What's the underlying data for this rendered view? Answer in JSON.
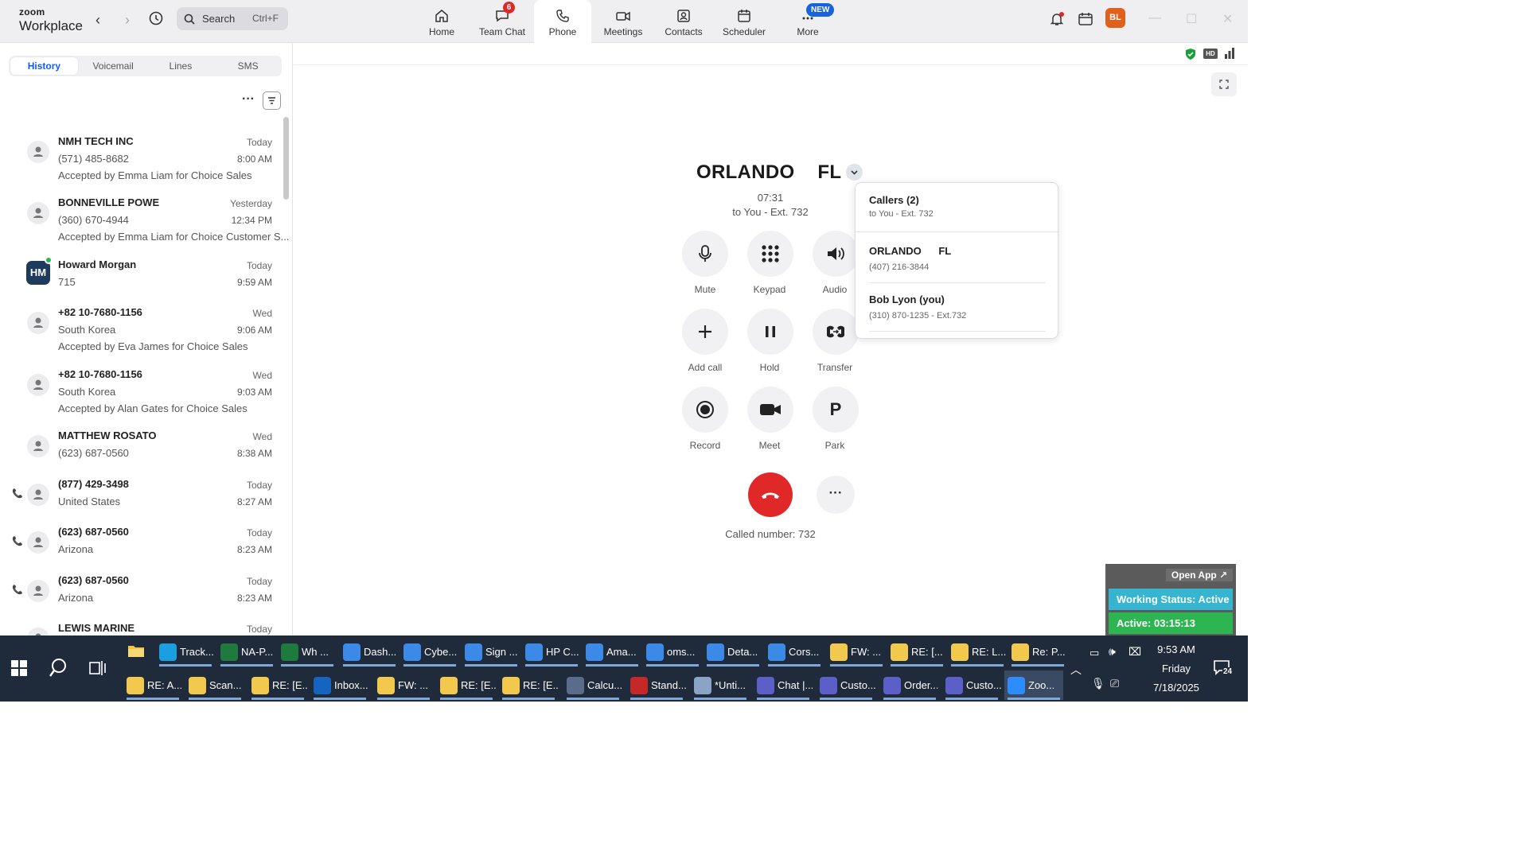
{
  "app": {
    "logo_top": "zoom",
    "logo_bottom": "Workplace"
  },
  "search": {
    "placeholder": "Search",
    "shortcut": "Ctrl+F"
  },
  "nav_tabs": [
    {
      "label": "Home",
      "badge": ""
    },
    {
      "label": "Team Chat",
      "badge": "6"
    },
    {
      "label": "Phone",
      "badge": ""
    },
    {
      "label": "Meetings",
      "badge": ""
    },
    {
      "label": "Contacts",
      "badge": ""
    },
    {
      "label": "Scheduler",
      "badge": ""
    },
    {
      "label": "More",
      "badge": "NEW"
    }
  ],
  "user_avatar": "BL",
  "sub_tabs": [
    "History",
    "Voicemail",
    "Lines",
    "SMS"
  ],
  "history": [
    {
      "name": "NMH TECH INC",
      "line2": "(571) 485-8682",
      "line3": "Accepted by Emma Liam for Choice Sales",
      "day": "Today",
      "time": "8:00 AM",
      "icon": "person-icon"
    },
    {
      "name": "BONNEVILLE POWE",
      "line2": "(360) 670-4944",
      "line3": "Accepted by Emma Liam for Choice Customer S...",
      "day": "Yesterday",
      "time": "12:34 PM",
      "icon": "person-icon"
    },
    {
      "name": "Howard Morgan",
      "line2": "715",
      "line3": "",
      "day": "Today",
      "time": "9:59 AM",
      "icon": "HM"
    },
    {
      "name": "+82 10-7680-1156",
      "line2": "South Korea",
      "line3": "Accepted by Eva James for Choice Sales",
      "day": "Wed",
      "time": "9:06 AM",
      "icon": "person-icon"
    },
    {
      "name": "+82 10-7680-1156",
      "line2": "South Korea",
      "line3": "Accepted by Alan Gates for Choice Sales",
      "day": "Wed",
      "time": "9:03 AM",
      "icon": "person-icon"
    },
    {
      "name": "MATTHEW ROSATO",
      "line2": "(623) 687-0560",
      "line3": "",
      "day": "Wed",
      "time": "8:38 AM",
      "icon": "person-icon"
    },
    {
      "name": "(877) 429-3498",
      "line2": "United States",
      "line3": "",
      "day": "Today",
      "time": "8:27 AM",
      "icon": "person-icon"
    },
    {
      "name": "(623) 687-0560",
      "line2": "Arizona",
      "line3": "",
      "day": "Today",
      "time": "8:23 AM",
      "icon": "person-icon"
    },
    {
      "name": "(623) 687-0560",
      "line2": "Arizona",
      "line3": "",
      "day": "Today",
      "time": "8:23 AM",
      "icon": "person-icon"
    },
    {
      "name": "LEWIS MARINE",
      "line2": "",
      "line3": "",
      "day": "Today",
      "time": "",
      "icon": "person-icon"
    }
  ],
  "call": {
    "caller_city": "ORLANDO",
    "caller_state": "FL",
    "duration": "07:31",
    "target": "to You - Ext. 732",
    "called_number": "Called number: 732",
    "controls": [
      "Mute",
      "Keypad",
      "Audio",
      "Add call",
      "Hold",
      "Transfer",
      "Record",
      "Meet",
      "Park"
    ],
    "park_letter": "P"
  },
  "callers_popup": {
    "title": "Callers (2)",
    "subtitle": "to You - Ext. 732",
    "entries": [
      {
        "name_a": "ORLANDO",
        "name_b": "FL",
        "detail": "(407) 216-3844"
      },
      {
        "name_a": "Bob Lyon (you)",
        "name_b": "",
        "detail": "(310) 870-1235 - Ext.732"
      }
    ]
  },
  "status_widget": {
    "open_app": "Open App ↗",
    "working_status": "Working Status: Active",
    "active_timer": "Active: 03:15:13"
  },
  "taskbar": {
    "row1": [
      "Track...",
      "NA-P...",
      "Wh ...",
      "Dash...",
      "Cybe...",
      "Sign ...",
      "HP C...",
      "Ama...",
      "oms...",
      "Deta...",
      "Cors...",
      "FW: ...",
      "RE: [...",
      "RE: L...",
      "Re: P..."
    ],
    "row2": [
      "RE: A...",
      "Scan...",
      "RE: [E...",
      "Inbox...",
      "FW: ...",
      "RE: [E...",
      "RE: [E...",
      "Calcu...",
      "Stand...",
      "*Unti...",
      "Chat |...",
      "Custo...",
      "Order...",
      "Custo...",
      "Zoo..."
    ],
    "clock_time": "9:53 AM",
    "clock_day": "Friday",
    "clock_date": "7/18/2025",
    "notif_count": "24"
  }
}
